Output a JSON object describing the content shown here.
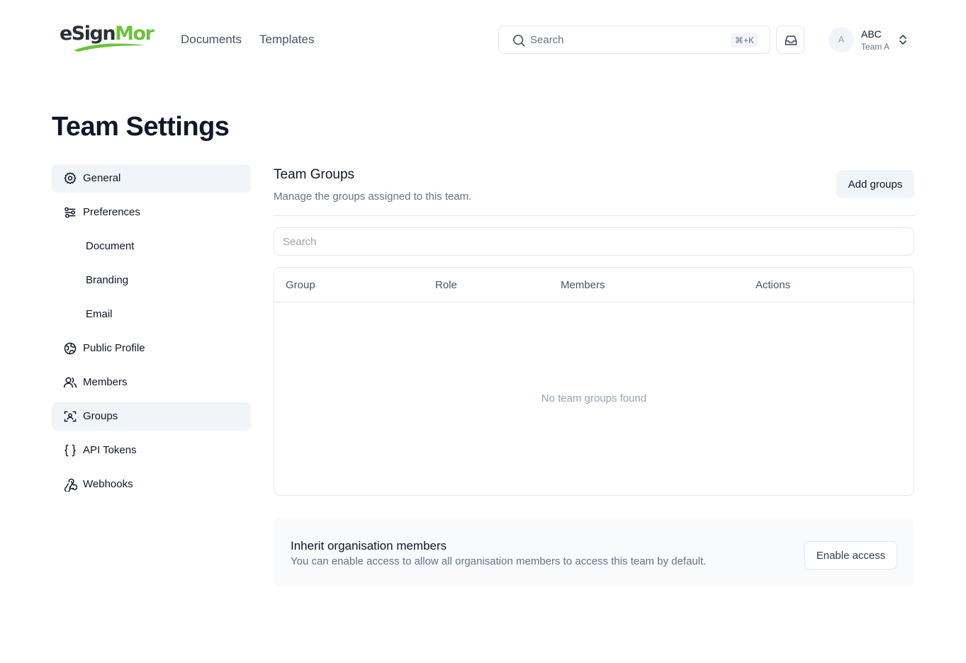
{
  "brand": {
    "logo_prefix": "eS",
    "logo_mid": "ign",
    "logo_suffix": "Mor",
    "accent": "#6cc23a"
  },
  "nav": {
    "documents": "Documents",
    "templates": "Templates"
  },
  "header_search": {
    "label": "Search",
    "shortcut": "⌘+K"
  },
  "account": {
    "avatar_initial": "A",
    "name": "ABC",
    "team": "Team A"
  },
  "page": {
    "title": "Team Settings"
  },
  "sidebar": {
    "items": [
      {
        "label": "General",
        "icon": "gear-icon"
      },
      {
        "label": "Preferences",
        "icon": "sliders-icon"
      },
      {
        "label": "Document"
      },
      {
        "label": "Branding"
      },
      {
        "label": "Email"
      },
      {
        "label": "Public Profile",
        "icon": "globe-icon"
      },
      {
        "label": "Members",
        "icon": "users-icon"
      },
      {
        "label": "Groups",
        "icon": "groups-icon"
      },
      {
        "label": "API Tokens",
        "icon": "braces-icon"
      },
      {
        "label": "Webhooks",
        "icon": "webhook-icon"
      }
    ]
  },
  "groups": {
    "title": "Team Groups",
    "description": "Manage the groups assigned to this team.",
    "add_button": "Add groups",
    "search_placeholder": "Search",
    "columns": [
      "Group",
      "Role",
      "Members",
      "Actions"
    ],
    "empty_text": "No team groups found"
  },
  "inherit": {
    "title": "Inherit organisation members",
    "description": "You can enable access to allow all organisation members to access this team by default.",
    "button": "Enable access"
  }
}
